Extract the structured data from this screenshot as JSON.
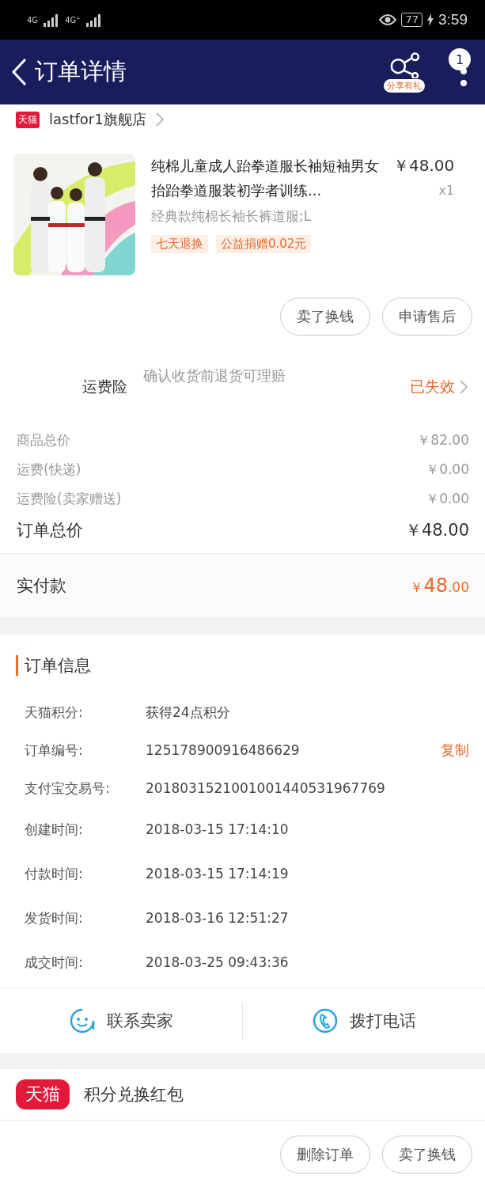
{
  "status_bar": {
    "time": "3:59",
    "battery": "77",
    "network_1": "4G",
    "network_2": "4G⁺"
  },
  "header": {
    "title": "订单详情",
    "share_badge": "分享有礼",
    "notification_count": "1"
  },
  "store": {
    "logo": "天猫",
    "name": "lastfor1旗舰店"
  },
  "product": {
    "title": "纯棉儿童成人跆拳道服长袖短袖男女抬跆拳道服装初学者训练...",
    "price": "￥48.00",
    "quantity": "x1",
    "variant": "经典款纯棉长袖长裤道服;L",
    "tags": [
      "七天退换",
      "公益捐赠0.02元"
    ]
  },
  "product_actions": [
    "卖了换钱",
    "申请售后"
  ],
  "insurance": {
    "label": "运费险",
    "description": "确认收货前退货可理赔",
    "status": "已失效"
  },
  "price_rows": [
    {
      "label": "商品总价",
      "value": "￥82.00"
    },
    {
      "label": "运费(快递)",
      "value": "￥0.00"
    },
    {
      "label": "运费险(卖家赠送)",
      "value": "￥0.00"
    }
  ],
  "order_total": {
    "label": "订单总价",
    "value": "￥48.00"
  },
  "paid": {
    "label": "实付款",
    "currency": "￥",
    "integer": "48",
    "decimal": ".00"
  },
  "order_info": {
    "title": "订单信息",
    "rows": [
      {
        "label": "天猫积分:",
        "value": "获得24点积分"
      },
      {
        "label": "订单编号:",
        "value": "125178900916486629",
        "action": "复制"
      },
      {
        "label": "支付宝交易号:",
        "value": "2018031521001001440531967769"
      },
      {
        "label": "创建时间:",
        "value": "2018-03-15 17:14:10"
      },
      {
        "label": "付款时间:",
        "value": "2018-03-15 17:14:19"
      },
      {
        "label": "发货时间:",
        "value": "2018-03-16 12:51:27"
      },
      {
        "label": "成交时间:",
        "value": "2018-03-25 09:43:36"
      }
    ]
  },
  "contact": [
    {
      "kind": "chat",
      "label": "联系卖家"
    },
    {
      "kind": "phone",
      "label": "拨打电话"
    }
  ],
  "promo": {
    "logo": "天猫",
    "title": "积分兑换红包"
  },
  "bottom_actions": [
    "删除订单",
    "卖了换钱"
  ]
}
